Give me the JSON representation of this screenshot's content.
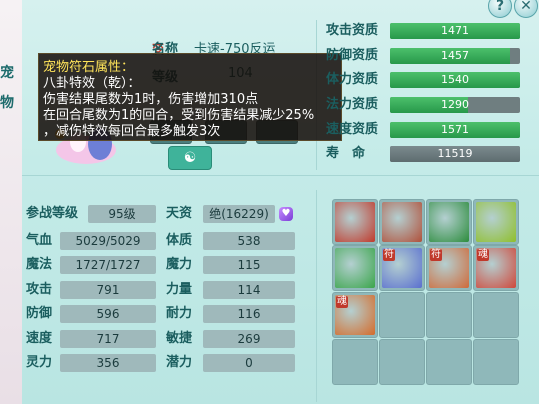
{
  "window": {
    "help_label": "?",
    "close_label": "✕"
  },
  "side_strip": {
    "chars": [
      "宠",
      "物"
    ]
  },
  "pet_info": {
    "badge": "变",
    "name_label": "名称",
    "name_value": "卡速-750反运",
    "level_label": "等级",
    "level_value": "104"
  },
  "tooltip": {
    "title": "宠物符石属性：",
    "lines": [
      "八卦特效（乾）：",
      "伤害结果尾数为1时，伤害增加310点",
      "在回合尾数为1的回合，受到伤害结果减少25%",
      "，减伤特效每回合最多触发3次"
    ]
  },
  "resistances": [
    {
      "label": "攻击资质",
      "value": "1471",
      "fill_percent": 100
    },
    {
      "label": "防御资质",
      "value": "1457",
      "fill_percent": 92
    },
    {
      "label": "体力资质",
      "value": "1540",
      "fill_percent": 100
    },
    {
      "label": "法力资质",
      "value": "1290",
      "fill_percent": 60
    },
    {
      "label": "速度资质",
      "value": "1571",
      "fill_percent": 100
    },
    {
      "label": "寿　命",
      "value": "11519",
      "fill_percent": 100,
      "gray": true
    }
  ],
  "stats": {
    "left": [
      {
        "label": "参战等级",
        "value": "95级"
      },
      {
        "label": "气血",
        "value": "5029/5029"
      },
      {
        "label": "魔法",
        "value": "1727/1727"
      },
      {
        "label": "攻击",
        "value": "791"
      },
      {
        "label": "防御",
        "value": "596"
      },
      {
        "label": "速度",
        "value": "717"
      },
      {
        "label": "灵力",
        "value": "356"
      }
    ],
    "right": [
      {
        "label": "天资",
        "value": "绝(16229)"
      },
      {
        "label": "体质",
        "value": "538"
      },
      {
        "label": "魔力",
        "value": "115"
      },
      {
        "label": "力量",
        "value": "114"
      },
      {
        "label": "耐力",
        "value": "116"
      },
      {
        "label": "敏捷",
        "value": "269"
      },
      {
        "label": "潜力",
        "value": "0"
      }
    ]
  },
  "skills": [
    {
      "name": "fist-skill-icon",
      "color": "#c0392b",
      "tag": ""
    },
    {
      "name": "scroll-skill-icon",
      "color": "#b0503a",
      "tag": ""
    },
    {
      "name": "beast-skill-icon",
      "color": "#2c8c3c",
      "tag": ""
    },
    {
      "name": "shield-skill-icon",
      "color": "#8fbf2a",
      "tag": ""
    },
    {
      "name": "run-skill-icon",
      "color": "#3aa54a",
      "tag": ""
    },
    {
      "name": "heart-rune-skill-icon",
      "color": "#5a6fcf",
      "tag": "符"
    },
    {
      "name": "sword-rune-skill-icon",
      "color": "#cf6a3a",
      "tag": "符"
    },
    {
      "name": "dragon-soul-skill-icon",
      "color": "#d0473a",
      "tag": "魂"
    },
    {
      "name": "strongman-soul-skill-icon",
      "color": "#d46b2a",
      "tag": "魂"
    }
  ]
}
